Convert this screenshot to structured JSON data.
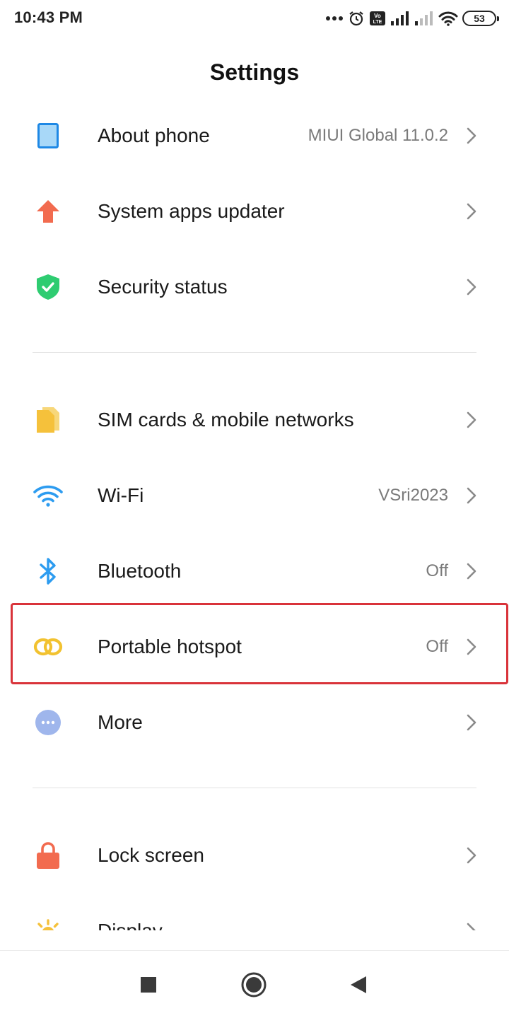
{
  "status_bar": {
    "time": "10:43 PM",
    "icons": [
      "dots-icon",
      "alarm-icon",
      "volte-icon",
      "signal-icon",
      "signal-weak-icon",
      "wifi-icon"
    ],
    "battery": "53"
  },
  "header": {
    "title": "Settings"
  },
  "sections": [
    {
      "items": [
        {
          "label": "About phone",
          "value": "MIUI Global 11.0.2",
          "icon": "phone-icon",
          "icon_color": "#1e88e5"
        },
        {
          "label": "System apps updater",
          "value": "",
          "icon": "arrow-up-icon",
          "icon_color": "#f26b4f"
        },
        {
          "label": "Security status",
          "value": "",
          "icon": "shield-check-icon",
          "icon_color": "#2ecc71"
        }
      ]
    },
    {
      "items": [
        {
          "label": "SIM cards & mobile networks",
          "value": "",
          "icon": "sim-card-icon",
          "icon_color": "#f5c13b"
        },
        {
          "label": "Wi-Fi",
          "value": "VSri2023",
          "icon": "wifi-icon",
          "icon_color": "#2d9cf0"
        },
        {
          "label": "Bluetooth",
          "value": "Off",
          "icon": "bluetooth-icon",
          "icon_color": "#2d9cf0"
        },
        {
          "label": "Portable hotspot",
          "value": "Off",
          "icon": "hotspot-link-icon",
          "icon_color": "#f2c230",
          "highlighted": true
        },
        {
          "label": "More",
          "value": "",
          "icon": "more-dots-icon",
          "icon_color": "#9fb6ec"
        }
      ]
    },
    {
      "items": [
        {
          "label": "Lock screen",
          "value": "",
          "icon": "lock-icon",
          "icon_color": "#f26b4f"
        },
        {
          "label": "Display",
          "value": "",
          "icon": "sun-icon",
          "icon_color": "#f5c13b"
        }
      ]
    }
  ],
  "highlight_color": "#d9333a",
  "nav_bar": {
    "buttons": [
      "recents-square-icon",
      "home-circle-icon",
      "back-triangle-icon"
    ]
  }
}
